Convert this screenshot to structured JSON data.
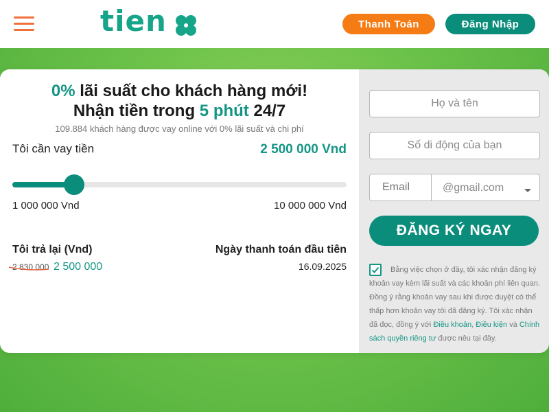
{
  "header": {
    "logo_text": "tien",
    "pay_button": "Thanh Toán",
    "login_button": "Đăng Nhập"
  },
  "calculator": {
    "headline_rate": "0%",
    "headline_line1_rest": " lãi suất cho khách hàng mới!",
    "headline_line2_start": "Nhận tiền trong ",
    "headline_line2_accent": "5 phút",
    "headline_line2_end": " 24/7",
    "subline": "109.884 khách hàng được vay online với 0% lãi suất và chi phí",
    "loan_label": "Tôi cần vay tiền",
    "loan_amount": "2 500 000 Vnd",
    "slider": {
      "min": 1000000,
      "max": 10000000,
      "value": 2500000
    },
    "range_min_label": "1 000 000 Vnd",
    "range_max_label": "10 000 000 Vnd",
    "repay_label": "Tôi trả lại (Vnd)",
    "old_price": "2 830 000",
    "new_price": "2 500 000",
    "first_payment_label": "Ngày thanh toán đầu tiên",
    "first_payment_date": "16.09.2025"
  },
  "form": {
    "name_placeholder": "Họ và tên",
    "phone_placeholder": "Số di động của bạn",
    "email_placeholder": "Email",
    "email_domain": "@gmail.com",
    "submit_label": "ĐĂNG KÝ NGAY",
    "consent_checked": true,
    "consent_text_1": "Bằng việc chọn ở đây, tôi xác nhận đăng ký khoản vay kèm lãi suất và các khoản phí liên quan. Đồng ý rằng khoản vay sau khi được duyệt có thể thấp hơn khoản vay tôi đã đăng ký. Tôi xác nhận đã đọc, đồng ý với ",
    "consent_link_terms": "Điều khoản",
    "consent_sep": ", ",
    "consent_link_conditions": "Điều kiện",
    "consent_and": " và ",
    "consent_link_privacy": "Chính sách quyền riêng tư",
    "consent_text_2": " được nêu tại đây."
  },
  "colors": {
    "brand_teal": "#0b8d7c",
    "accent_orange": "#f57c14",
    "background_green": "#6cc24a"
  },
  "icons": [
    "menu-icon",
    "clover-icon",
    "chevron-down-icon",
    "checkmark-icon"
  ]
}
